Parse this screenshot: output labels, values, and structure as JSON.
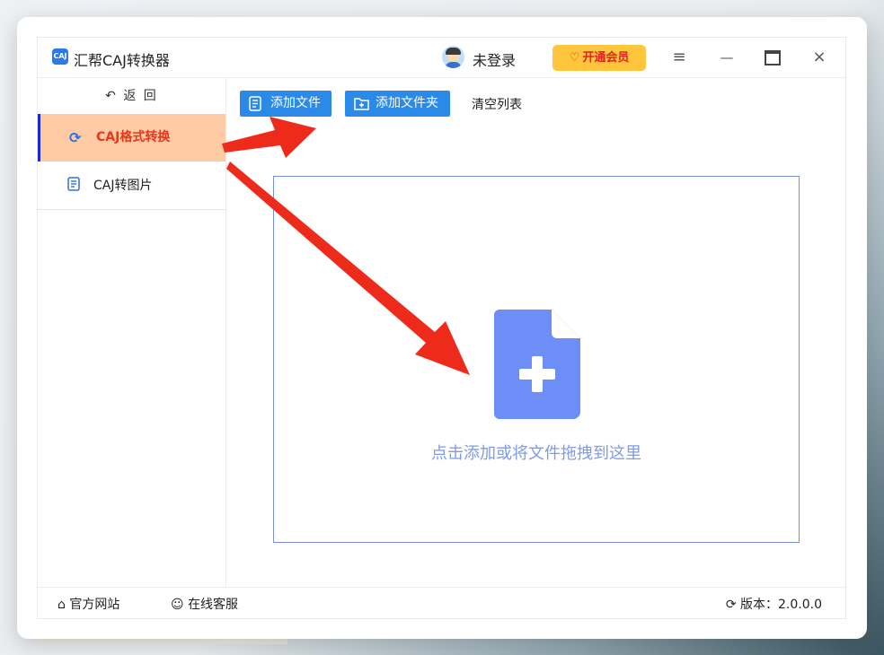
{
  "app": {
    "title": "汇帮CAJ转换器",
    "logo_text": "CAJ",
    "login": "未登录",
    "vip_label": "开通会员"
  },
  "window_controls": {
    "menu": "≡",
    "minimize": "—",
    "close": "×"
  },
  "sidebar": {
    "back_label": "返 回",
    "items": [
      {
        "label": "CAJ格式转换",
        "active": true,
        "icon": "refresh-icon"
      },
      {
        "label": "CAJ转图片",
        "active": false,
        "icon": "document-icon"
      }
    ]
  },
  "toolbar": {
    "add_file": "添加文件",
    "add_folder": "添加文件夹",
    "clear_list": "清空列表"
  },
  "dropzone": {
    "hint": "点击添加或将文件拖拽到这里",
    "icon": "add-file-icon",
    "border_color": "#7a8fe0",
    "icon_color": "#6e8ef7"
  },
  "footer": {
    "website": "官方网站",
    "support": "在线客服",
    "version_label": "版本：2.0.0.0"
  },
  "colors": {
    "primary": "#2b8ae8",
    "vip_bg": "#ffc53d",
    "active_nav_bg": "#ffcba4",
    "active_nav_text": "#e8361a",
    "annotation_arrow": "#ee2a1b"
  }
}
